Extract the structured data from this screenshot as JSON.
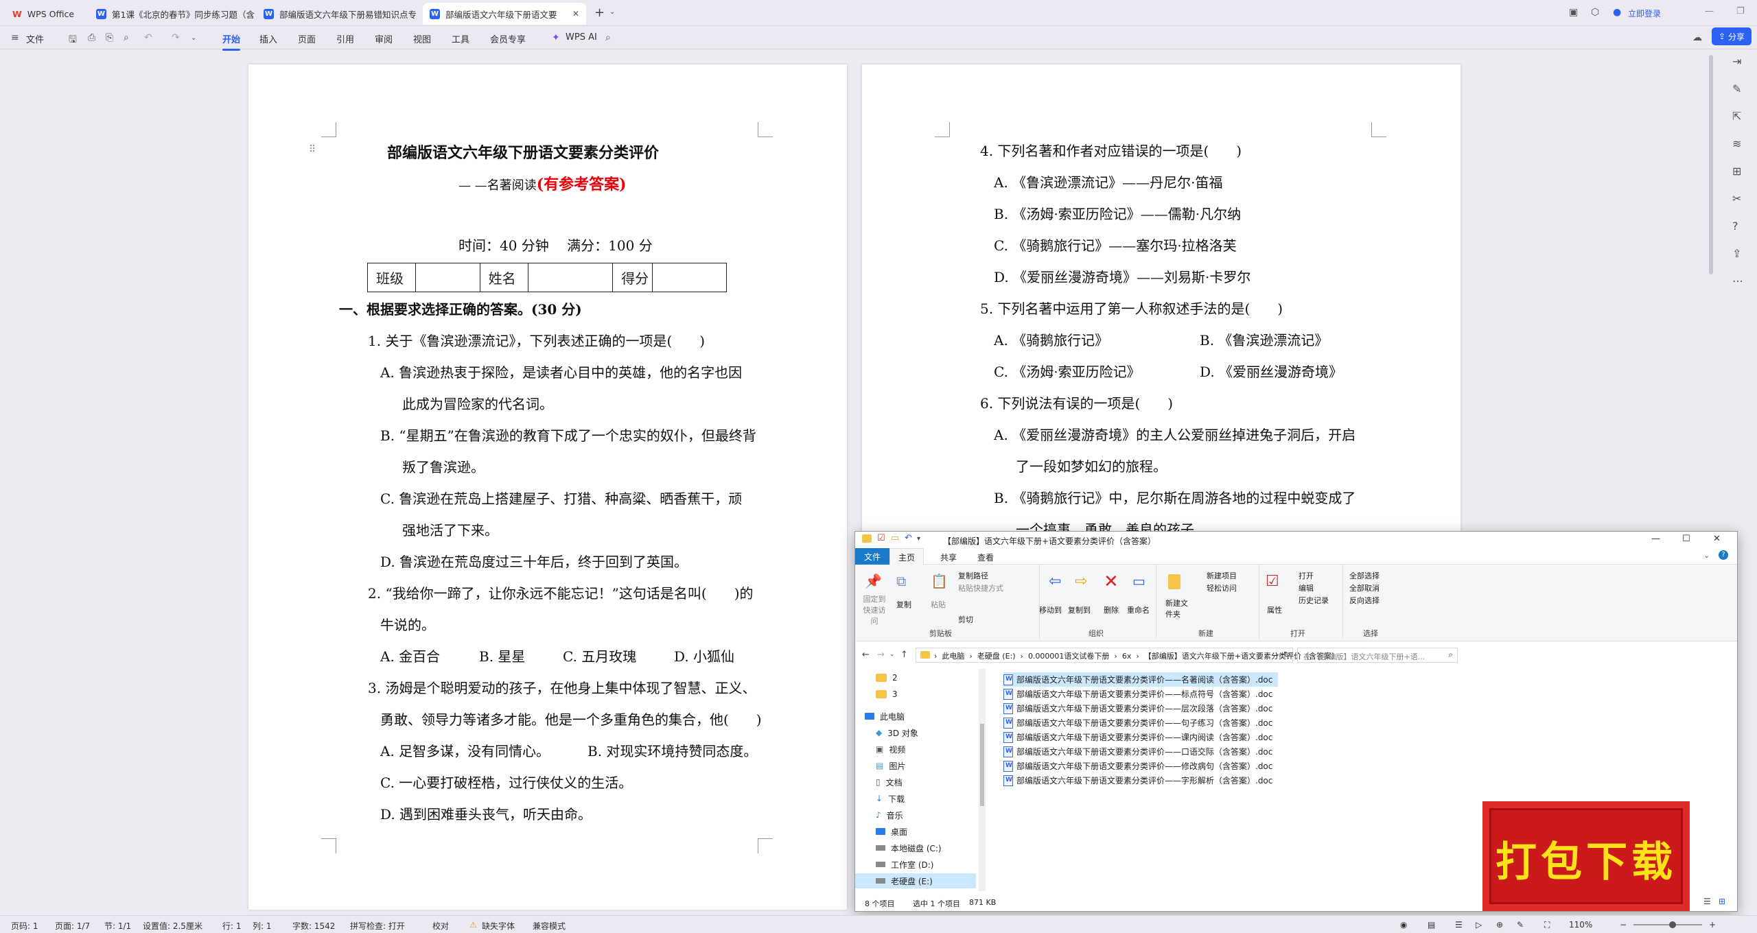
{
  "tabs": {
    "home": "WPS Office",
    "tab1": "第1课《北京的春节》同步练习题（含",
    "tab2": "部编版语文六年级下册易错知识点专",
    "tab3": "部编版语文六年级下册语文要",
    "add": "+"
  },
  "titlebar": {
    "login": "立即登录",
    "share": "分享"
  },
  "ribbon": {
    "file": "文件",
    "tabs": [
      "开始",
      "插入",
      "页面",
      "引用",
      "审阅",
      "视图",
      "工具",
      "会员专享"
    ],
    "wps_ai": "WPS AI"
  },
  "doc_left": {
    "title": "部编版语文六年级下册语文要素分类评价",
    "sub_prefix": "— —名著阅读",
    "sub_red": "(有参考答案)",
    "meta": "时间：40 分钟　 满分：100 分",
    "table": [
      "班级",
      "姓名",
      "得分"
    ],
    "section1": "一、根据要求选择正确的答案。(30 分)",
    "lines": [
      "1. 关于《鲁滨逊漂流记》，下列表述正确的一项是(　　)",
      "A. 鲁滨逊热衷于探险，是读者心目中的英雄，他的名字也因",
      "此成为冒险家的代名词。",
      "B. “星期五”在鲁滨逊的教育下成了一个忠实的奴仆，但最终背",
      "叛了鲁滨逊。",
      "C. 鲁滨逊在荒岛上搭建屋子、打猎、种高粱、晒香蕉干，顽",
      "强地活了下来。",
      "D. 鲁滨逊在荒岛度过三十年后，终于回到了英国。",
      "2. “我给你一蹄了，让你永远不能忘记！”这句话是名叫(　　)的",
      "牛说的。",
      "3. 汤姆是个聪明爱动的孩子，在他身上集中体现了智慧、正义、",
      "勇敢、领导力等诸多才能。他是一个多重角色的集合，他(　　)",
      "C. 一心要打破桎梏，过行侠仗义的生活。",
      "D. 遇到困难垂头丧气，听天由命。"
    ],
    "q2_options": [
      "A. 金百合",
      "B. 星星",
      "C. 五月玫瑰",
      "D. 小狐仙"
    ],
    "q3_ab": [
      "A. 足智多谋，没有同情心。",
      "B. 对现实环境持赞同态度。"
    ]
  },
  "doc_right": {
    "lines": [
      "4. 下列名著和作者对应错误的一项是(　　)",
      "A. 《鲁滨逊漂流记》——丹尼尔·笛福",
      "B. 《汤姆·索亚历险记》——儒勒·凡尔纳",
      "C. 《骑鹅旅行记》——塞尔玛·拉格洛芙",
      "D. 《爱丽丝漫游奇境》——刘易斯·卡罗尔",
      "5. 下列名著中运用了第一人称叙述手法的是(　　)",
      "6. 下列说法有误的一项是(　　)",
      "A. 《爱丽丝漫游奇境》的主人公爱丽丝掉进兔子洞后，开启",
      "了一段如梦如幻的旅程。",
      "B. 《骑鹅旅行记》中，尼尔斯在周游各地的过程中蜕变成了",
      "一个搞事、勇敢、善良的孩子。"
    ],
    "q5_options": [
      "A. 《骑鹅旅行记》",
      "B. 《鲁滨逊漂流记》",
      "C. 《汤姆·索亚历险记》",
      "D. 《爱丽丝漫游奇境》"
    ]
  },
  "explorer": {
    "title": "【部编版】语文六年级下册+语文要素分类评价（含答案）",
    "menu": [
      "文件",
      "主页",
      "共享",
      "查看"
    ],
    "ribbon": {
      "pin": "固定到快速访问",
      "copy": "复制",
      "paste": "粘贴",
      "copy_path": "复制路径",
      "paste_shortcut": "粘贴快捷方式",
      "cut": "剪切",
      "move_to": "移动到",
      "copy_to": "复制到",
      "delete": "删除",
      "rename": "重命名",
      "new_folder": "新建文件夹",
      "new_item": "新建项目",
      "easy_access": "轻松访问",
      "properties": "属性",
      "open": "打开",
      "edit": "编辑",
      "history": "历史记录",
      "select_all": "全部选择",
      "select_none": "全部取消",
      "invert": "反向选择"
    },
    "groups": [
      "剪贴板",
      "组织",
      "新建",
      "打开",
      "选择"
    ],
    "breadcrumb": [
      "此电脑",
      "老硬盘 (E:)",
      "0.000001语文试卷下册",
      "6x",
      "【部编版】语文六年级下册+语文要素分类评价（含答案）"
    ],
    "search_placeholder": "在 【部编版】语文六年级下册+语...",
    "nav": [
      "2",
      "3",
      "此电脑",
      "3D 对象",
      "视频",
      "图片",
      "文档",
      "下载",
      "音乐",
      "桌面",
      "本地磁盘 (C:)",
      "工作室 (D:)",
      "老硬盘 (E:)"
    ],
    "files": [
      "部编版语文六年级下册语文要素分类评价——名著阅读（含答案）.doc",
      "部编版语文六年级下册语文要素分类评价——标点符号（含答案）.doc",
      "部编版语文六年级下册语文要素分类评价——层次段落（含答案）.doc",
      "部编版语文六年级下册语文要素分类评价——句子练习（含答案）.doc",
      "部编版语文六年级下册语文要素分类评价——课内阅读（含答案）.doc",
      "部编版语文六年级下册语文要素分类评价——口语交际（含答案）.doc",
      "部编版语文六年级下册语文要素分类评价——修改病句（含答案）.doc",
      "部编版语文六年级下册语文要素分类评价——字形解析（含答案）.doc"
    ],
    "status": {
      "count": "8 个项目",
      "selected": "选中 1 个项目",
      "size": "871 KB"
    }
  },
  "stamp": "打包下载",
  "statusbar": {
    "page": "页码: 1",
    "pages": "页面: 1/7",
    "section": "节: 1/1",
    "setting": "设置值: 2.5厘米",
    "row": "行: 1",
    "col": "列: 1",
    "words": "字数: 1542",
    "spell": "拼写检查: 打开",
    "proof": "校对",
    "missing_font": "缺失字体",
    "compat": "兼容模式",
    "zoom": "110%"
  }
}
